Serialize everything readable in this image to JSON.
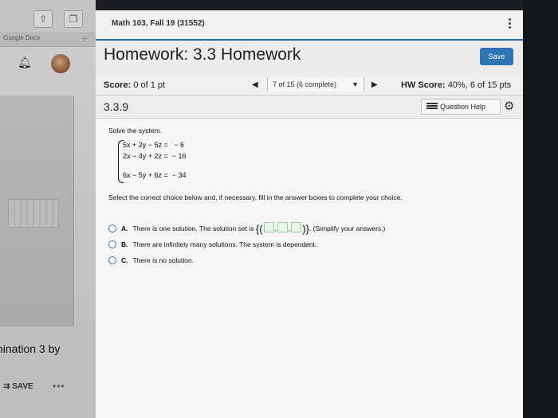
{
  "sidebar": {
    "tab_label": "Google Docs",
    "tab_plus": "+",
    "bottom_text": "nination 3 by",
    "save_label": "SAVE",
    "more_label": "•••"
  },
  "header": {
    "course_title": "Math 103, Fall 19 (31552)"
  },
  "homework": {
    "title": "Homework: 3.3 Homework",
    "save_label": "Save"
  },
  "score_bar": {
    "score_label": "Score:",
    "score_value": "0 of 1 pt",
    "question_nav": "7 of 15 (6 complete)",
    "hw_score_label": "HW Score:",
    "hw_score_value": "40%, 6 of 15 pts"
  },
  "question": {
    "number": "3.3.9",
    "help_label": "Question Help",
    "instruction": "Solve the system.",
    "equations": [
      "5x + 2y − 5z =   − 6",
      "2x − 4y + 2z =  − 16",
      "6x − 5y + 6z =  − 34"
    ],
    "select_prompt": "Select the correct choice below and, if necessary, fill in the answer boxes to complete your choice.",
    "choices": [
      {
        "letter": "A.",
        "text_before": "There is one solution. The solution set is",
        "text_after": ". (Simplify your answers.)"
      },
      {
        "letter": "B.",
        "text": "There are infinitely many solutions. The system is dependent."
      },
      {
        "letter": "C.",
        "text": "There is no solution."
      }
    ]
  }
}
